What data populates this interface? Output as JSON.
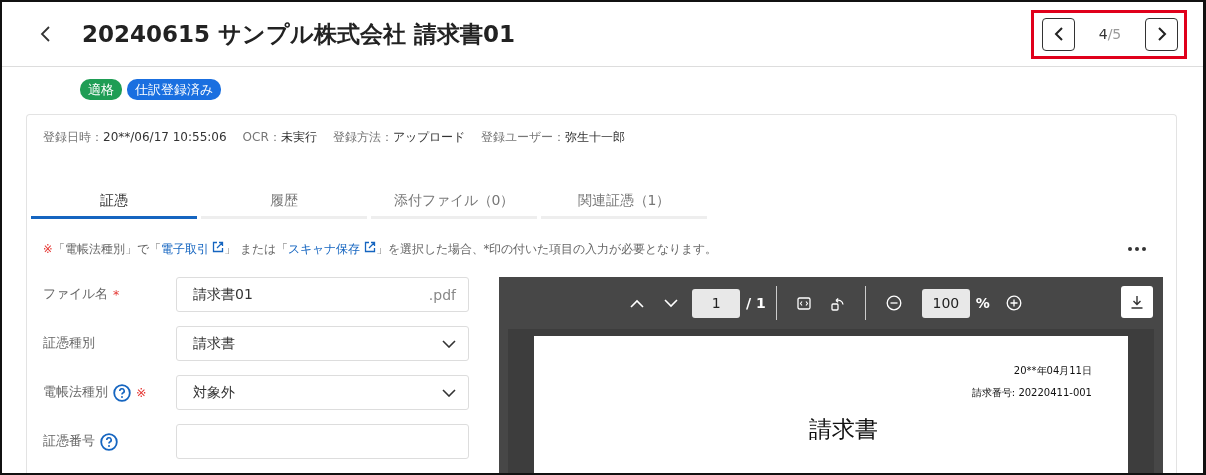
{
  "header": {
    "title": "20240615 サンプル株式会社 請求書01",
    "pager": {
      "current": "4",
      "total": "/5",
      "highlighted": true
    }
  },
  "badges": [
    {
      "label": "適格",
      "color": "#1f9d55"
    },
    {
      "label": "仕訳登録済み",
      "color": "#1a6fe0"
    }
  ],
  "meta": [
    {
      "label": "登録日時：",
      "value": "20**/06/17 10:55:06"
    },
    {
      "label": "OCR：",
      "value": "未実行"
    },
    {
      "label": "登録方法：",
      "value": "アップロード"
    },
    {
      "label": "登録ユーザー：",
      "value": "弥生十一郎"
    }
  ],
  "tabs": [
    {
      "label": "証憑",
      "selected": true
    },
    {
      "label": "履歴",
      "selected": false
    },
    {
      "label": "添付ファイル（0）",
      "selected": false
    },
    {
      "label": "関連証憑（1）",
      "selected": false
    }
  ],
  "notice": [
    {
      "kind": "mark",
      "text": "※"
    },
    {
      "kind": "text",
      "text": "「電帳法種別」で「"
    },
    {
      "kind": "link",
      "text": "電子取引"
    },
    {
      "kind": "text",
      "text": "」 または「"
    },
    {
      "kind": "link",
      "text": "スキャナ保存"
    },
    {
      "kind": "text",
      "text": "」を選択した場合、*印の付いた項目の入力が必要となります。"
    }
  ],
  "fields": [
    {
      "kind": "text",
      "label": "ファイル名",
      "required_mark": "*",
      "value": "請求書01",
      "suffix": ".pdf"
    },
    {
      "kind": "select",
      "label": "証憑種別",
      "value": "請求書"
    },
    {
      "kind": "select",
      "label": "電帳法種別",
      "help": true,
      "note_mark": "※",
      "value": "対象外"
    },
    {
      "kind": "text",
      "label": "証憑番号",
      "help": true
    }
  ],
  "viewer": {
    "page": "1",
    "page_total": "/ 1",
    "zoom": "100",
    "zoom_unit": "%",
    "document": {
      "date": "20**年04月11日",
      "number": "請求番号: 20220411-001",
      "title": "請求書"
    }
  }
}
